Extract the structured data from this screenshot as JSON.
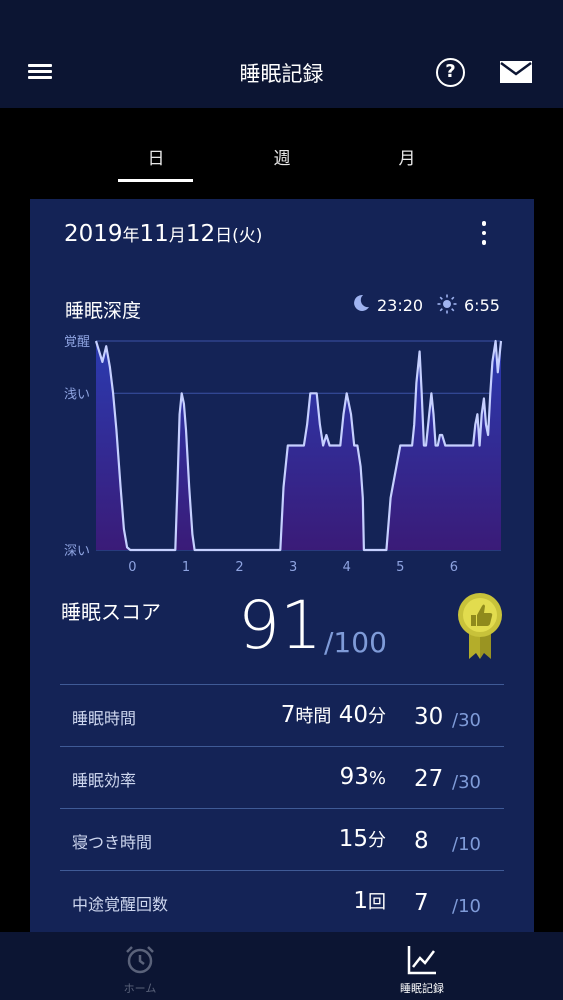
{
  "header": {
    "title": "睡眠記録"
  },
  "tabs": [
    {
      "label": "日"
    },
    {
      "label": "週"
    },
    {
      "label": "月"
    }
  ],
  "card": {
    "date": {
      "year": "2019",
      "year_unit": "年",
      "month": "11",
      "month_unit": "月",
      "day": "12",
      "day_unit": "日",
      "weekday": "(火)"
    },
    "depth_title": "睡眠深度",
    "bedtime": "23:20",
    "waketime": "6:55"
  },
  "chart_data": {
    "type": "area",
    "title": "睡眠深度",
    "y_levels": [
      "覚醒",
      "浅い",
      "深い"
    ],
    "x_ticks": [
      "0",
      "1",
      "2",
      "3",
      "4",
      "5",
      "6"
    ],
    "xlim": [
      -0.68,
      6.88
    ],
    "ylim": [
      0,
      4
    ],
    "x": [
      -0.68,
      -0.56,
      -0.49,
      -0.42,
      -0.36,
      -0.3,
      -0.22,
      -0.16,
      -0.1,
      -0.04,
      0.8,
      0.84,
      0.88,
      0.92,
      0.96,
      1.0,
      1.06,
      1.12,
      1.16,
      1.54,
      2.76,
      2.82,
      2.9,
      3.2,
      3.26,
      3.32,
      3.44,
      3.5,
      3.56,
      3.62,
      3.68,
      3.88,
      3.94,
      4.0,
      4.08,
      4.14,
      4.2,
      4.26,
      4.3,
      4.32,
      4.54,
      4.74,
      4.82,
      5.0,
      5.22,
      5.26,
      5.3,
      5.36,
      5.4,
      5.44,
      5.48,
      5.5,
      5.54,
      5.58,
      5.62,
      5.66,
      5.7,
      5.74,
      5.78,
      5.84,
      5.9,
      6.36,
      6.4,
      6.44,
      6.46,
      6.48,
      6.52,
      6.56,
      6.6,
      6.64,
      6.68,
      6.72,
      6.78,
      6.82,
      6.88
    ],
    "y": [
      4,
      3.6,
      3.9,
      3.5,
      3.0,
      2.3,
      1.2,
      0.4,
      0.05,
      0,
      0,
      1.2,
      2.6,
      3.0,
      2.8,
      2.3,
      1.2,
      0.3,
      0,
      0,
      0,
      1.2,
      2.0,
      2.0,
      2.4,
      3.0,
      3.0,
      2.4,
      2.0,
      2.2,
      2.0,
      2.0,
      2.6,
      3.0,
      2.6,
      2.0,
      2.0,
      1.6,
      1.0,
      0,
      0,
      0,
      1.0,
      2.0,
      2.0,
      2.4,
      3.2,
      3.8,
      3.0,
      2.0,
      2.0,
      2.2,
      2.6,
      3.0,
      2.6,
      2.0,
      2.0,
      2.2,
      2.2,
      2.0,
      2.0,
      2.0,
      2.4,
      2.6,
      2.3,
      2.0,
      2.6,
      2.9,
      2.4,
      2.2,
      3.0,
      3.6,
      4.0,
      3.4,
      4.0
    ]
  },
  "score": {
    "label": "睡眠スコア",
    "value": "91",
    "max": "/100"
  },
  "metrics": [
    {
      "label": "睡眠時間",
      "value_a": "7",
      "unit_a": "時間",
      "value_b": "40",
      "unit_b": "分",
      "points": "30",
      "max": "/30"
    },
    {
      "label": "睡眠効率",
      "value_a": "93",
      "unit_a": "%",
      "points": "27",
      "max": "/30"
    },
    {
      "label": "寝つき時間",
      "value_a": "15",
      "unit_a": "分",
      "points": "8",
      "max": "/10"
    },
    {
      "label": "中途覚醒回数",
      "value_a": "1",
      "unit_a": "回",
      "points": "7",
      "max": "/10"
    }
  ],
  "nav": [
    {
      "label": "ホーム"
    },
    {
      "label": "睡眠記録"
    }
  ],
  "colors": {
    "header_bg": "#0c1533",
    "card_bg": "#142356",
    "accent": "#7f9bd8",
    "line": "#a8b8ff",
    "medal": "#c8c23a"
  }
}
